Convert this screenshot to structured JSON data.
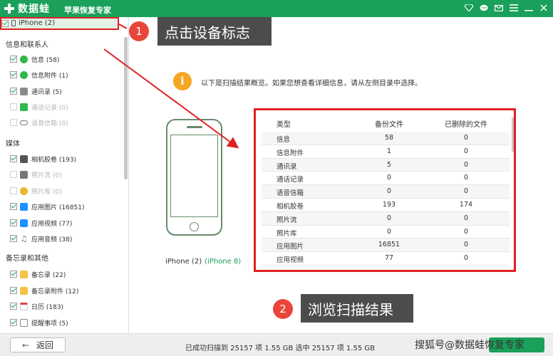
{
  "app": {
    "logo_text": "数据蛙",
    "subtitle": "苹果恢复专家"
  },
  "titlebar_icons": [
    "diamond-icon",
    "chat-icon",
    "mail-icon",
    "menu-icon",
    "minimize-icon",
    "close-icon"
  ],
  "colors": {
    "brand_green": "#1aa05a",
    "highlight_red": "#e02020",
    "callout_bg": "#4c4c4c",
    "warning_orange": "#f5a623"
  },
  "sidebar": {
    "device": {
      "label": "iPhone (2)",
      "checked": true
    },
    "groups": [
      {
        "title": "信息和联系人",
        "items": [
          {
            "label": "信息 (58)",
            "checked": true,
            "enabled": true,
            "icon": "message-icon",
            "icon_color": "#2fb84a"
          },
          {
            "label": "信息附件 (1)",
            "checked": true,
            "enabled": true,
            "icon": "attachment-icon",
            "icon_color": "#2fb84a"
          },
          {
            "label": "通讯录 (5)",
            "checked": true,
            "enabled": true,
            "icon": "contacts-icon",
            "icon_color": "#7a7a7a"
          },
          {
            "label": "通话记录 (0)",
            "checked": false,
            "enabled": false,
            "icon": "phone-icon",
            "icon_color": "#2fb84a"
          },
          {
            "label": "语音信箱 (0)",
            "checked": false,
            "enabled": false,
            "icon": "voicemail-icon",
            "icon_color": "#555555"
          }
        ]
      },
      {
        "title": "媒体",
        "items": [
          {
            "label": "相机胶卷 (193)",
            "checked": true,
            "enabled": true,
            "icon": "camera-icon",
            "icon_color": "#555555"
          },
          {
            "label": "照片流 (0)",
            "checked": false,
            "enabled": false,
            "icon": "photo-stream-icon",
            "icon_color": "#555555"
          },
          {
            "label": "照片库 (0)",
            "checked": false,
            "enabled": false,
            "icon": "photo-library-icon",
            "icon_color": "#e8b830"
          },
          {
            "label": "应用图片 (16851)",
            "checked": true,
            "enabled": true,
            "icon": "app-photo-icon",
            "icon_color": "#1e90ff"
          },
          {
            "label": "应用视频 (77)",
            "checked": true,
            "enabled": true,
            "icon": "app-video-icon",
            "icon_color": "#1e90ff"
          },
          {
            "label": "应用音频 (38)",
            "checked": true,
            "enabled": true,
            "icon": "music-note-icon",
            "icon_color": "#888888"
          }
        ]
      },
      {
        "title": "备忘录和其他",
        "items": [
          {
            "label": "备忘录 (22)",
            "checked": true,
            "enabled": true,
            "icon": "notes-icon",
            "icon_color": "#f5c242"
          },
          {
            "label": "备忘录附件 (12)",
            "checked": true,
            "enabled": true,
            "icon": "notes-attachment-icon",
            "icon_color": "#f5c242"
          },
          {
            "label": "日历 (183)",
            "checked": true,
            "enabled": true,
            "icon": "calendar-icon",
            "icon_color": "#e04040"
          },
          {
            "label": "提醒事项 (5)",
            "checked": true,
            "enabled": true,
            "icon": "reminders-icon",
            "icon_color": "#555555"
          }
        ]
      }
    ]
  },
  "main": {
    "info_text": "以下是扫描结果概览。如果您想查看详细信息，请从左侧目录中选择。",
    "info_icon_glyph": "i",
    "device_name": "iPhone (2)",
    "device_model": "(iPhone 8)",
    "table": {
      "headers": [
        "类型",
        "备份文件",
        "已删除的文件"
      ],
      "rows": [
        [
          "信息",
          "58",
          "0"
        ],
        [
          "信息附件",
          "1",
          "0"
        ],
        [
          "通讯录",
          "5",
          "0"
        ],
        [
          "通话记录",
          "0",
          "0"
        ],
        [
          "语音信箱",
          "0",
          "0"
        ],
        [
          "相机胶卷",
          "193",
          "174"
        ],
        [
          "照片流",
          "0",
          "0"
        ],
        [
          "照片库",
          "0",
          "0"
        ],
        [
          "应用图片",
          "16851",
          "0"
        ],
        [
          "应用视频",
          "77",
          "0"
        ]
      ]
    }
  },
  "annotations": {
    "step1": {
      "number": "1",
      "text": "点击设备标志"
    },
    "step2": {
      "number": "2",
      "text": "浏览扫描结果"
    }
  },
  "bottom": {
    "back_label": "返回",
    "status_text": "已成功扫描到 25157 项 1.55 GB  选中 25157 项 1.55 GB",
    "watermark": "搜狐号@数据蛙恢复专家"
  }
}
